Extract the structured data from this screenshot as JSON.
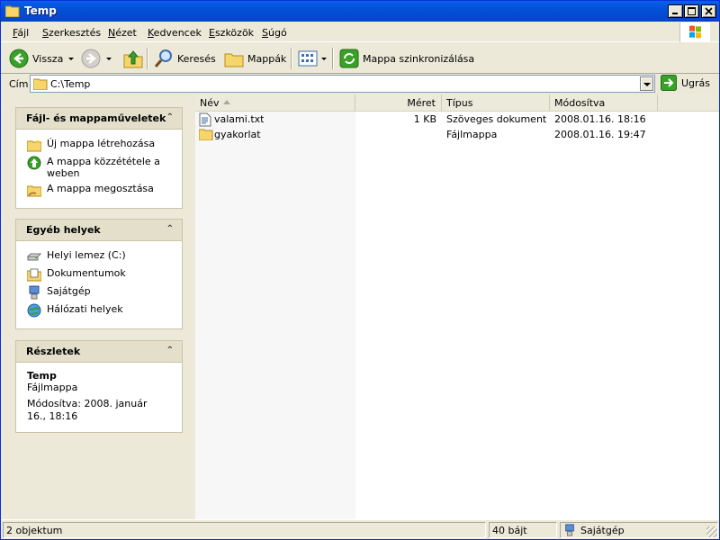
{
  "window": {
    "title": "Temp"
  },
  "menu": {
    "items": [
      {
        "u": "F",
        "rest": "ájl"
      },
      {
        "u": "S",
        "rest": "zerkesztés"
      },
      {
        "u": "N",
        "rest": "ézet"
      },
      {
        "u": "K",
        "rest": "edvencek"
      },
      {
        "u": "E",
        "rest": "szközök"
      },
      {
        "u": "S",
        "rest": "úgó"
      }
    ]
  },
  "toolbar": {
    "back": "Vissza",
    "search": "Keresés",
    "folders": "Mappák",
    "sync": "Mappa szinkronizálása"
  },
  "address": {
    "label": "Cím",
    "value": "C:\\Temp",
    "go": "Ugrás"
  },
  "tasks": {
    "file_ops": {
      "title": "Fájl- és mappaműveletek",
      "items": [
        "Új mappa létrehozása",
        "A mappa közzététele a weben",
        "A mappa megosztása"
      ]
    },
    "other_places": {
      "title": "Egyéb helyek",
      "items": [
        "Helyi lemez (C:)",
        "Dokumentumok",
        "Sajátgép",
        "Hálózati helyek"
      ]
    },
    "details": {
      "title": "Részletek",
      "name": "Temp",
      "type": "Fájlmappa",
      "modified": "Módosítva: 2008. január 16., 18:16"
    }
  },
  "list": {
    "columns": [
      "Név",
      "Méret",
      "Típus",
      "Módosítva"
    ],
    "rows": [
      {
        "name": "valami.txt",
        "size": "1 KB",
        "type": "Szöveges dokument...",
        "modified": "2008.01.16. 18:16",
        "icon": "text-file-icon"
      },
      {
        "name": "gyakorlat",
        "size": "",
        "type": "Fájlmappa",
        "modified": "2008.01.16. 19:47",
        "icon": "folder-icon"
      }
    ]
  },
  "status": {
    "objects": "2 objektum",
    "size": "40 bájt",
    "location": "Sajátgép"
  },
  "colors": {
    "titlebar": "#0450d8",
    "window_bg": "#ece9d8",
    "pane": "#ece9d8"
  }
}
